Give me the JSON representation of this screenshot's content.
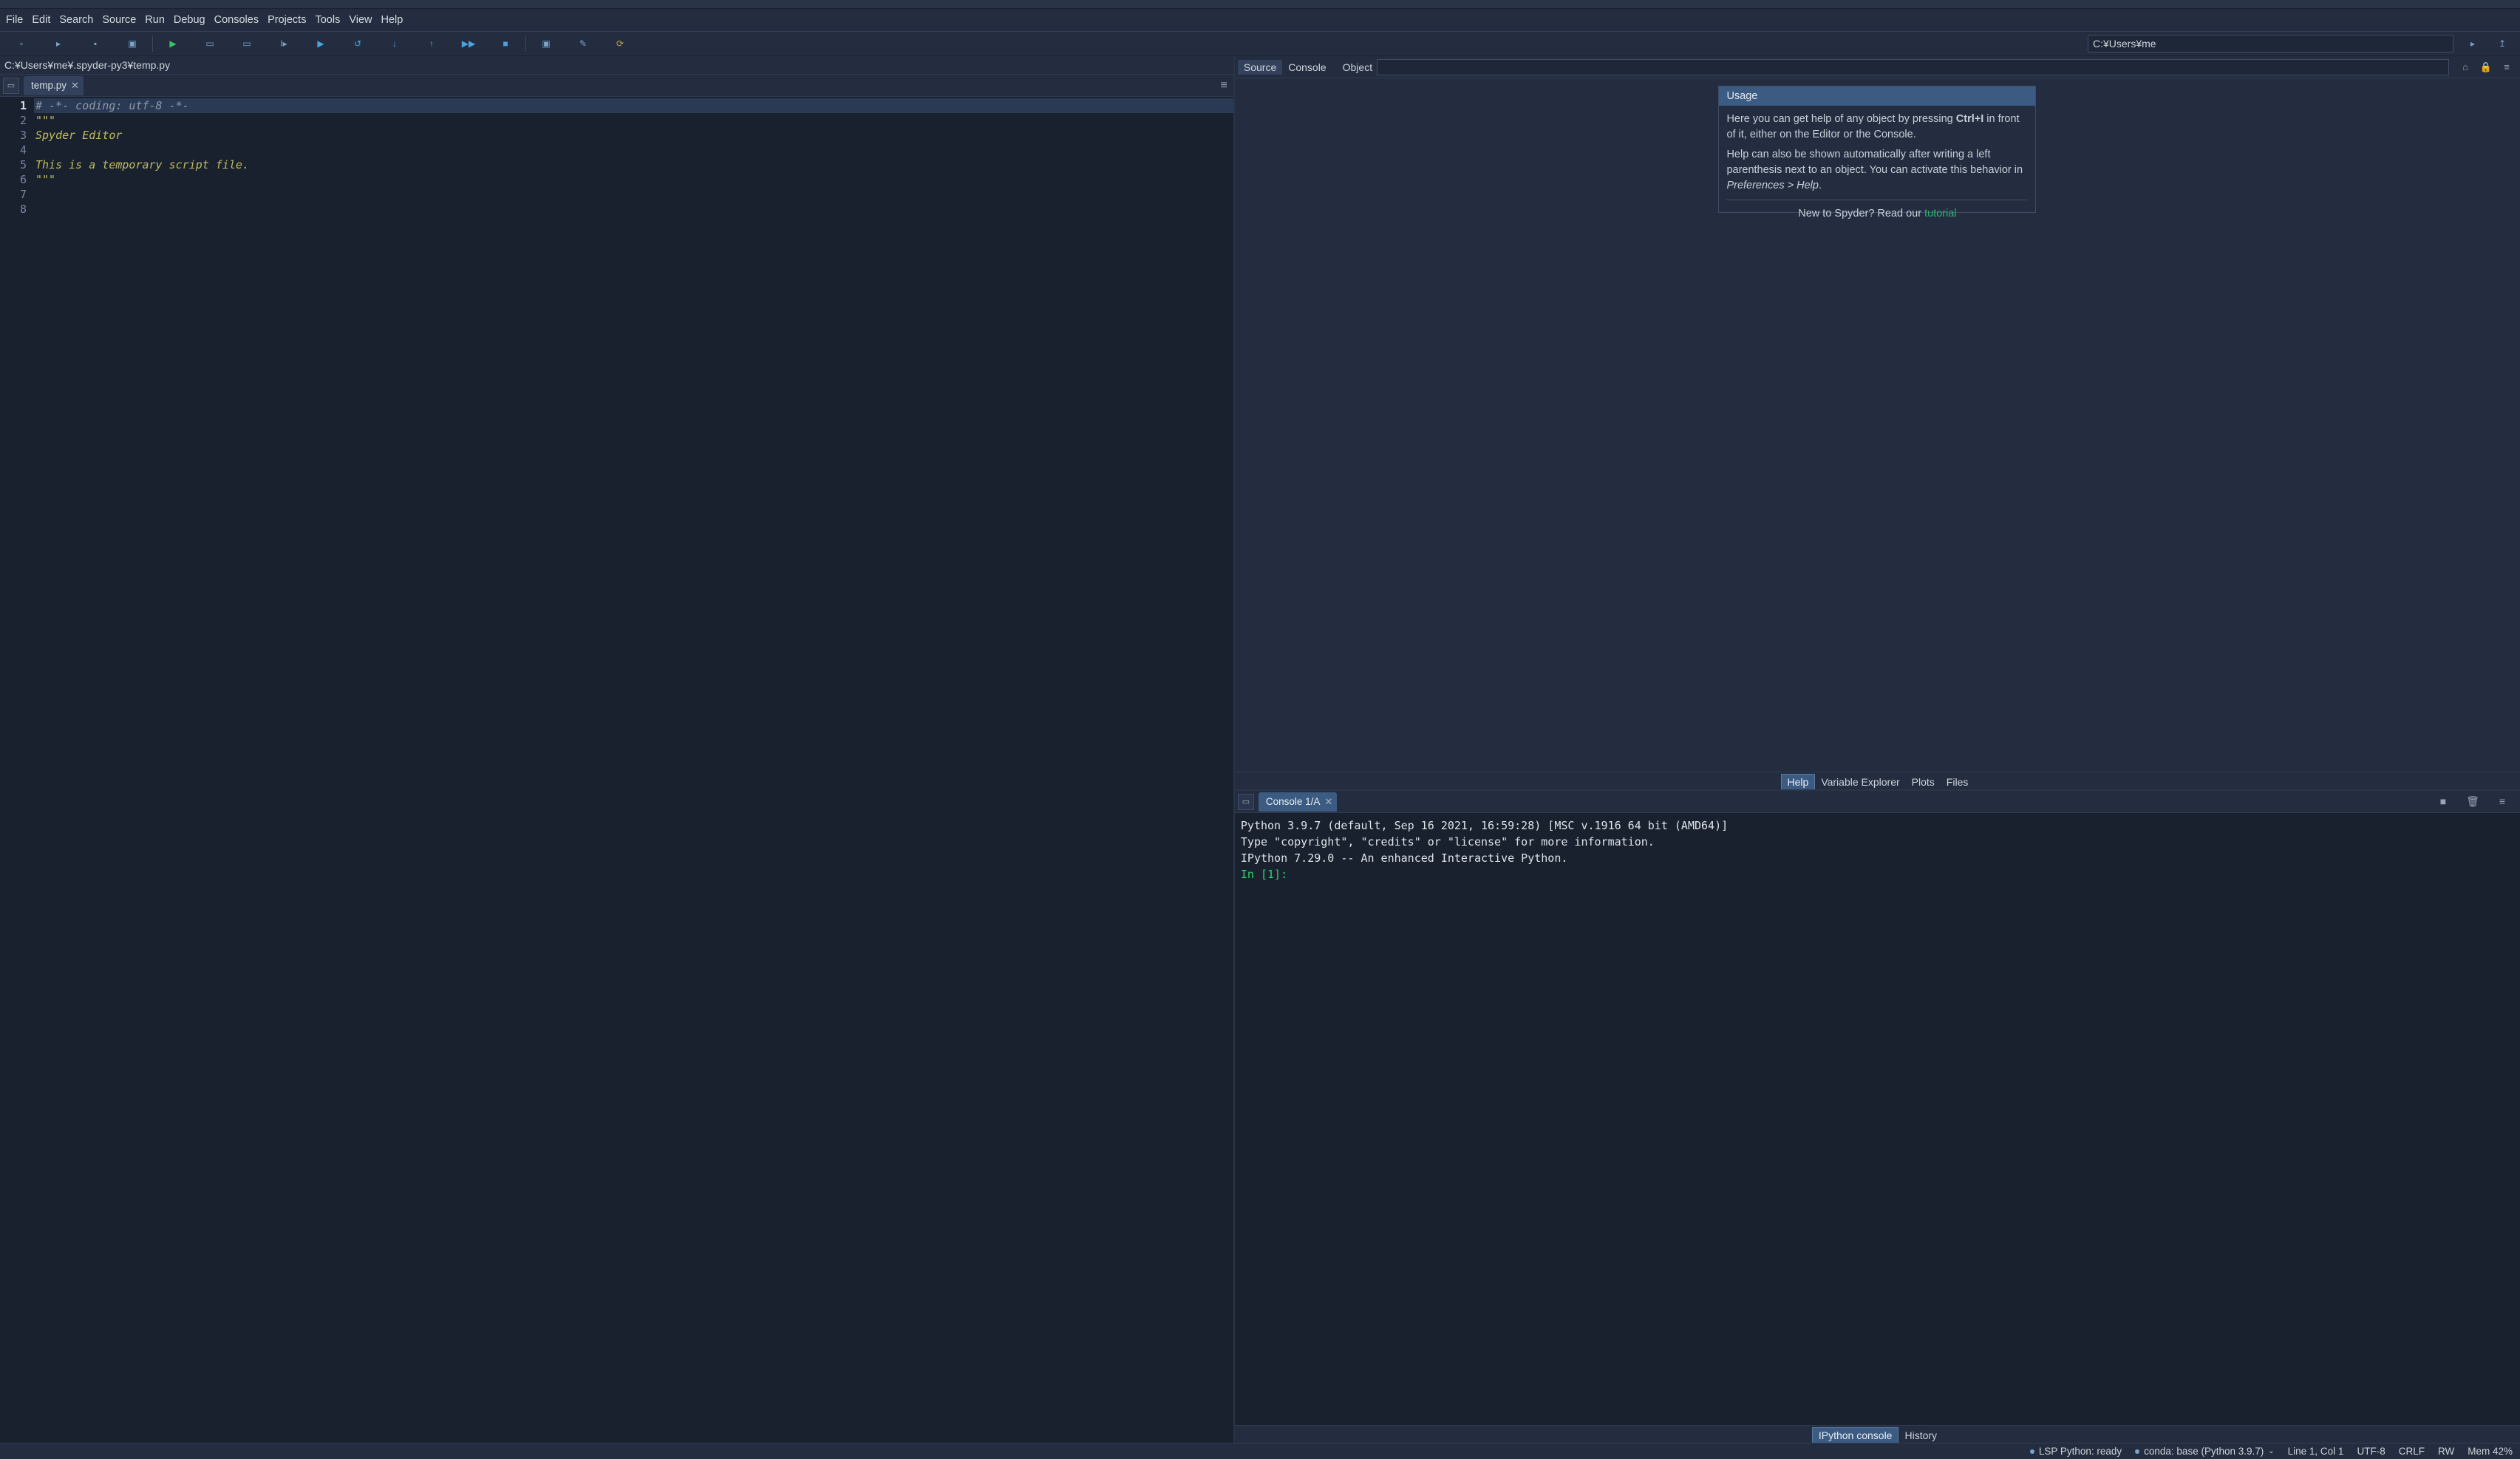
{
  "menu": [
    "File",
    "Edit",
    "Search",
    "Source",
    "Run",
    "Debug",
    "Consoles",
    "Projects",
    "Tools",
    "View",
    "Help"
  ],
  "toolbar_icons": [
    {
      "n": "new-file-icon",
      "g": "▫"
    },
    {
      "n": "open-file-icon",
      "g": "▸"
    },
    {
      "n": "save-file-icon",
      "g": "▪"
    },
    {
      "n": "save-all-icon",
      "g": "▣"
    },
    {
      "sep": true
    },
    {
      "n": "run-icon",
      "g": "▶",
      "c": "#3bbf6a"
    },
    {
      "n": "run-cell-icon",
      "g": "▭"
    },
    {
      "n": "run-cell-advance-icon",
      "g": "▭"
    },
    {
      "n": "run-selection-icon",
      "g": "I▸"
    },
    {
      "n": "debug-icon",
      "g": "▶",
      "c": "#4aa3e0"
    },
    {
      "n": "debug-step-icon",
      "g": "↺",
      "c": "#4aa3e0"
    },
    {
      "n": "step-in-icon",
      "g": "↓",
      "c": "#4aa3e0"
    },
    {
      "n": "step-out-icon",
      "g": "↑",
      "c": "#4aa3e0"
    },
    {
      "n": "continue-icon",
      "g": "▶▶",
      "c": "#4aa3e0"
    },
    {
      "n": "stop-debug-icon",
      "g": "■",
      "c": "#4aa3e0"
    },
    {
      "sep": true
    },
    {
      "n": "maximize-icon",
      "g": "▣"
    },
    {
      "n": "preferences-icon",
      "g": "✎"
    },
    {
      "n": "pythonpath-icon",
      "g": "⟳",
      "c": "#c9a24a"
    }
  ],
  "working_dir": "C:¥Users¥me",
  "right_toolbar_icons": [
    {
      "n": "browse-dir-icon",
      "g": "▸"
    },
    {
      "n": "parent-dir-icon",
      "g": "↥"
    }
  ],
  "editor": {
    "path": "C:¥Users¥me¥.spyder-py3¥temp.py",
    "tab": "temp.py",
    "lines": [
      {
        "n": 1,
        "cls": "cmt",
        "txt": "# -*- coding: utf-8 -*-",
        "hl": true
      },
      {
        "n": 2,
        "cls": "str",
        "txt": "\"\"\""
      },
      {
        "n": 3,
        "cls": "str",
        "txt": "Spyder Editor"
      },
      {
        "n": 4,
        "cls": "str",
        "txt": ""
      },
      {
        "n": 5,
        "cls": "str",
        "txt": "This is a temporary script file."
      },
      {
        "n": 6,
        "cls": "str",
        "txt": "\"\"\""
      },
      {
        "n": 7,
        "cls": "",
        "txt": ""
      },
      {
        "n": 8,
        "cls": "",
        "txt": ""
      }
    ]
  },
  "help": {
    "sources": [
      "Source",
      "Console"
    ],
    "object_label": "Object",
    "title": "Usage",
    "p1a": "Here you can get help of any object by pressing ",
    "p1b": "Ctrl+I",
    "p1c": " in front of it, either on the Editor or the Console.",
    "p2a": "Help can also be shown automatically after writing a left parenthesis next to an object. You can activate this behavior in ",
    "p2b": "Preferences > Help",
    "p2c": ".",
    "tut_a": "New to Spyder? Read our ",
    "tut_b": "tutorial",
    "top_icons": [
      {
        "n": "home-icon",
        "g": "⌂"
      },
      {
        "n": "lock-icon",
        "g": "🔒"
      },
      {
        "n": "options-icon",
        "g": "≡"
      }
    ],
    "bottom_tabs": [
      "Help",
      "Variable Explorer",
      "Plots",
      "Files"
    ],
    "bottom_sel": 0
  },
  "console": {
    "tab": "Console 1/A",
    "top_icons": [
      {
        "n": "interrupt-icon",
        "g": "■"
      },
      {
        "n": "clear-icon",
        "g": "🗑"
      },
      {
        "n": "options-icon",
        "g": "≡"
      }
    ],
    "body_lines": [
      "Python 3.9.7 (default, Sep 16 2021, 16:59:28) [MSC v.1916 64 bit (AMD64)]",
      "Type \"copyright\", \"credits\" or \"license\" for more information.",
      "",
      "IPython 7.29.0 -- An enhanced Interactive Python.",
      ""
    ],
    "prompt": "In [1]:",
    "bottom_tabs": [
      "IPython console",
      "History"
    ],
    "bottom_sel": 0
  },
  "status": {
    "lsp": "LSP Python: ready",
    "conda": "conda: base (Python 3.9.7)",
    "pos": "Line 1, Col 1",
    "enc": "UTF-8",
    "eol": "CRLF",
    "rw": "RW",
    "mem": "Mem 42%"
  }
}
